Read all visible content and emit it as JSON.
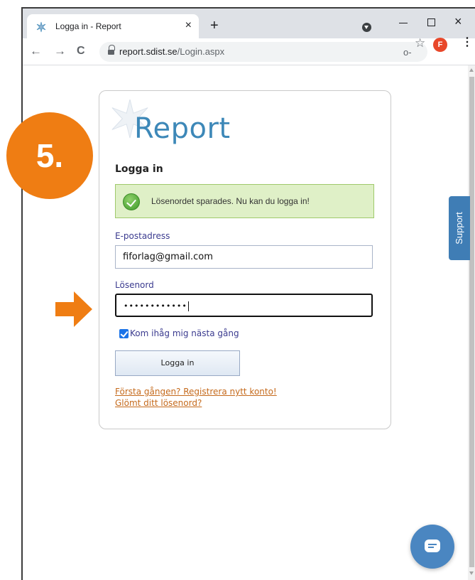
{
  "browser": {
    "tab_title": "Logga in - Report",
    "tab_close": "×",
    "new_tab": "+",
    "window_close": "×",
    "url_host": "report.sdist.se",
    "url_path": "/Login.aspx",
    "profile_initial": "F",
    "back": "←",
    "forward": "→",
    "reload": "C",
    "menu": "⋮",
    "bookmark_star": "☆",
    "key_glyph": "o-"
  },
  "page": {
    "logo_text": "Report",
    "title": "Logga in",
    "alert_message": "Lösenordet sparades. Nu kan du logga in!",
    "email_label": "E-postadress",
    "email_value": "fiforlag@gmail.com",
    "password_label": "Lösenord",
    "password_mask": "••••••••••••",
    "remember_label": "Kom ihåg mig nästa gång",
    "remember_checked": true,
    "login_button": "Logga in",
    "register_link": "Första gången? Registrera nytt konto!",
    "forgot_link": "Glömt ditt lösenord?"
  },
  "overlay": {
    "step_label": "5.",
    "step_color": "#ef7d13"
  },
  "widgets": {
    "support_label": "Support"
  },
  "colors": {
    "accent_blue": "#3d88b8",
    "link_orange": "#c56a1c",
    "success_bg": "#dff0c7"
  }
}
